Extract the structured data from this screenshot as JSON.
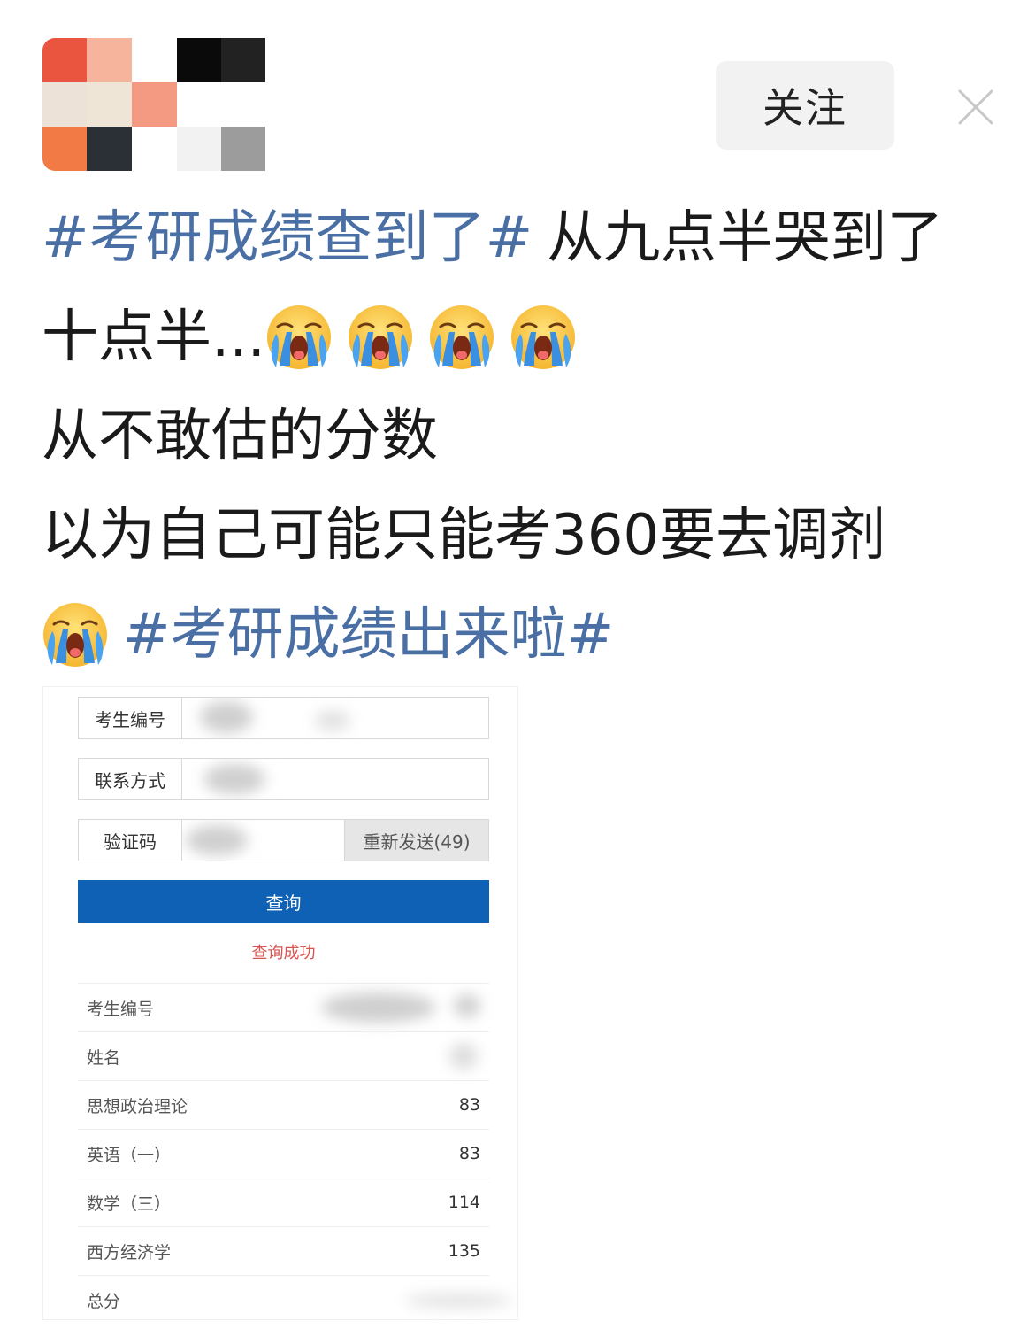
{
  "header": {
    "follow_label": "关注"
  },
  "post": {
    "line1_tag": "#考研成绩查到了#",
    "line1_text": "从九点半哭到了",
    "line2_text": "十点半...",
    "line3_text": "从不敢估的分数",
    "line4_text": "以为自己可能只能考360要去调剂",
    "line5_tag": "#考研成绩出来啦#",
    "emoji_name": "crying-face"
  },
  "form": {
    "fields": [
      {
        "label": "考生编号"
      },
      {
        "label": "联系方式"
      },
      {
        "label": "验证码"
      }
    ],
    "resend_label": "重新发送(49)",
    "query_label": "查询",
    "success_message": "查询成功"
  },
  "results": [
    {
      "label": "考生编号",
      "value": ""
    },
    {
      "label": "姓名",
      "value": ""
    },
    {
      "label": "思想政治理论",
      "value": "83"
    },
    {
      "label": "英语（一）",
      "value": "83"
    },
    {
      "label": "数学（三）",
      "value": "114"
    },
    {
      "label": "西方经济学",
      "value": "135"
    },
    {
      "label": "总分",
      "value": ""
    }
  ],
  "colors": {
    "hashtag": "#4a6fa5",
    "query_button": "#0f61b5",
    "success": "#d9534f"
  }
}
